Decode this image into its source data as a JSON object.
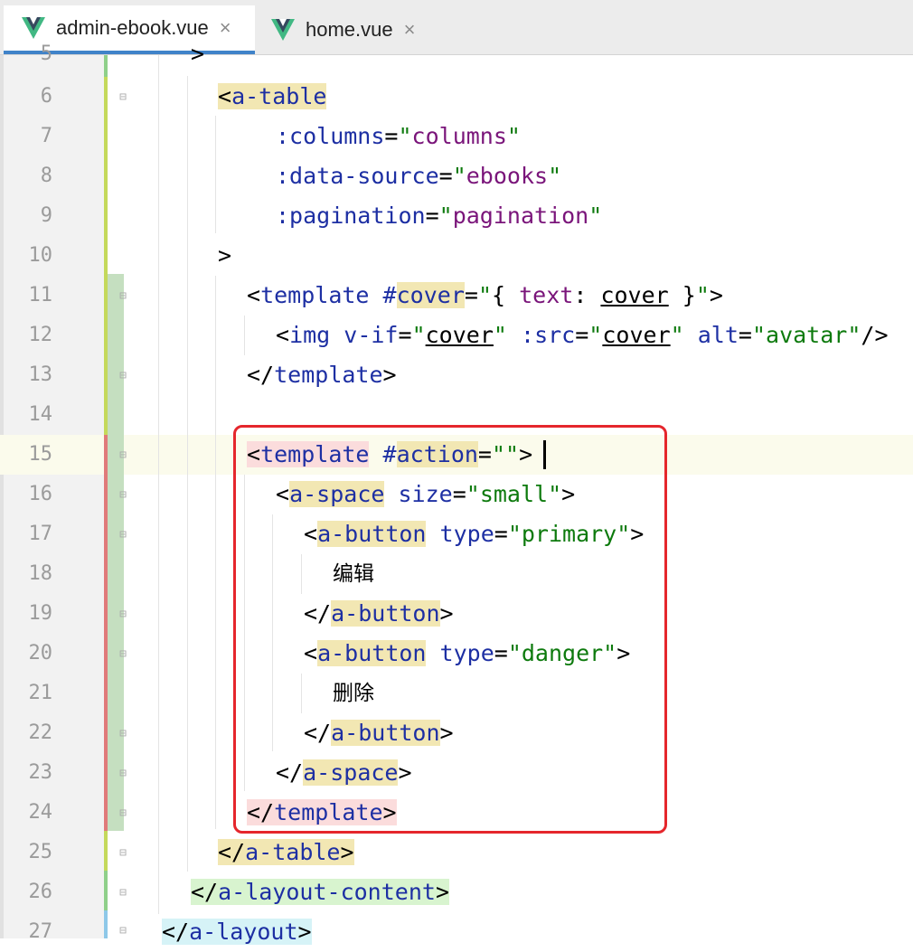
{
  "tabs": [
    {
      "label": "admin-ebook.vue",
      "active": true,
      "close": "×"
    },
    {
      "label": "home.vue",
      "active": false,
      "close": "×"
    }
  ],
  "editor": {
    "lines": [
      {
        "n": "5",
        "text": ">"
      },
      {
        "n": "6",
        "text": "<a-table"
      },
      {
        "n": "7",
        "text": ":columns=\"columns\""
      },
      {
        "n": "8",
        "text": ":data-source=\"ebooks\""
      },
      {
        "n": "9",
        "text": ":pagination=\"pagination\""
      },
      {
        "n": "10",
        "text": ">"
      },
      {
        "n": "11",
        "text": "<template #cover=\"{ text: cover }\">"
      },
      {
        "n": "12",
        "text": "<img v-if=\"cover\" :src=\"cover\" alt=\"avatar\"/>"
      },
      {
        "n": "13",
        "text": "</template>"
      },
      {
        "n": "14",
        "text": ""
      },
      {
        "n": "15",
        "text": "<template #action=\"\">"
      },
      {
        "n": "16",
        "text": "<a-space size=\"small\">"
      },
      {
        "n": "17",
        "text": "<a-button type=\"primary\">"
      },
      {
        "n": "18",
        "text": "编辑"
      },
      {
        "n": "19",
        "text": "</a-button>"
      },
      {
        "n": "20",
        "text": "<a-button type=\"danger\">"
      },
      {
        "n": "21",
        "text": "删除"
      },
      {
        "n": "22",
        "text": "</a-button>"
      },
      {
        "n": "23",
        "text": "</a-space>"
      },
      {
        "n": "24",
        "text": "</template>"
      },
      {
        "n": "25",
        "text": "</a-table>"
      },
      {
        "n": "26",
        "text": "</a-layout-content>"
      },
      {
        "n": "27",
        "text": "</a-layout>"
      }
    ],
    "current_line": "15"
  },
  "colors": {
    "tag": "#1d2fa3",
    "string": "#0d7a0d",
    "value": "#7a157a",
    "annotation_box": "#e5262c",
    "active_tab_underline": "#4083c9"
  },
  "icons": [
    "vue-logo-icon",
    "close-icon",
    "fold-marker-icon"
  ]
}
